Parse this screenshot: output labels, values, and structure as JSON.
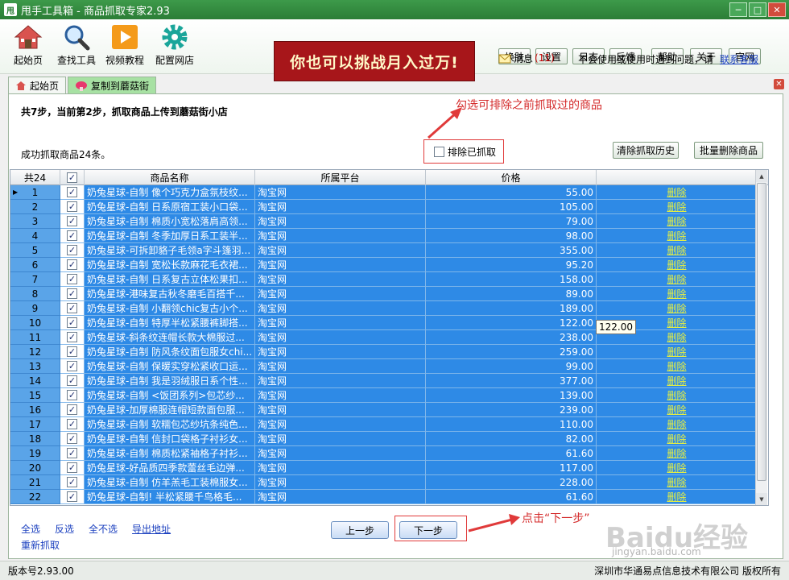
{
  "window": {
    "logo_text": "甩",
    "title": "甩手工具箱 - 商品抓取专家2.93",
    "buttons": [
      "─",
      "□",
      "✕"
    ]
  },
  "toolbar": {
    "tools": [
      {
        "label": "起始页",
        "icon": "home-icon"
      },
      {
        "label": "查找工具",
        "icon": "magnifier-icon"
      },
      {
        "label": "视频教程",
        "icon": "play-icon"
      },
      {
        "label": "配置网店",
        "icon": "gear-icon"
      }
    ],
    "banner": "你也可以挑战月入过万!",
    "top_buttons": [
      "换肤",
      "设置",
      "日志",
      "反馈",
      "帮助",
      "关于",
      "官网"
    ],
    "message_label": "消息",
    "message_count": "(11)",
    "help_text": "不会使用或使用时遇到问题，请",
    "help_link": "联系客服"
  },
  "tabs": [
    {
      "label": "起始页",
      "icon": "home-icon",
      "active": false
    },
    {
      "label": "复制到蘑菇街",
      "icon": "mushroom-icon",
      "active": true
    }
  ],
  "step": {
    "text": "共7步，当前第2步，抓取商品上传到蘑菇街小店",
    "success": "成功抓取商品24条。",
    "exclude_label": "排除已抓取",
    "clear_history": "清除抓取历史",
    "batch_delete": "批量删除商品",
    "annotation_top": "勾选可排除之前抓取过的商品",
    "annotation_next": "点击“下一步”"
  },
  "table": {
    "headers": [
      "共24",
      "",
      "商品名称",
      "所属平台",
      "价格",
      ""
    ],
    "rows": [
      {
        "n": "1",
        "name": "奶兔星球-自制 像个巧克力盒氛枝纹...",
        "platform": "淘宝网",
        "price": "55.00",
        "action": "删除"
      },
      {
        "n": "2",
        "name": "奶兔星球-自制 日系原宿工装小口袋...",
        "platform": "淘宝网",
        "price": "105.00",
        "action": "删除"
      },
      {
        "n": "3",
        "name": "奶兔星球-自制 棉质小宽松落肩高领...",
        "platform": "淘宝网",
        "price": "79.00",
        "action": "删除"
      },
      {
        "n": "4",
        "name": "奶兔星球-自制 冬季加厚日系工装半...",
        "platform": "淘宝网",
        "price": "98.00",
        "action": "删除"
      },
      {
        "n": "5",
        "name": "奶兔星球-可拆卸貉子毛领a字斗篷羽...",
        "platform": "淘宝网",
        "price": "355.00",
        "action": "删除"
      },
      {
        "n": "6",
        "name": "奶兔星球-自制 宽松长款麻花毛衣裙...",
        "platform": "淘宝网",
        "price": "95.20",
        "action": "删除"
      },
      {
        "n": "7",
        "name": "奶兔星球-自制 日系复古立体松果扣...",
        "platform": "淘宝网",
        "price": "158.00",
        "action": "删除"
      },
      {
        "n": "8",
        "name": "奶兔星球-港味复古秋冬磨毛百搭千...",
        "platform": "淘宝网",
        "price": "89.00",
        "action": "删除"
      },
      {
        "n": "9",
        "name": "奶兔星球-自制 小翻领chic复古小个...",
        "platform": "淘宝网",
        "price": "189.00",
        "action": "删除"
      },
      {
        "n": "10",
        "name": "奶兔星球-自制 特厚半松紧腰裤脚搭...",
        "platform": "淘宝网",
        "price": "122.00",
        "action": "删除"
      },
      {
        "n": "11",
        "name": "奶兔星球-斜条纹连帽长款大棉服过...",
        "platform": "淘宝网",
        "price": "238.00",
        "action": "删除"
      },
      {
        "n": "12",
        "name": "奶兔星球-自制 防风条纹面包服女chi...",
        "platform": "淘宝网",
        "price": "259.00",
        "action": "删除"
      },
      {
        "n": "13",
        "name": "奶兔星球-自制 保暖实穿松紧收口运...",
        "platform": "淘宝网",
        "price": "99.00",
        "action": "删除"
      },
      {
        "n": "14",
        "name": "奶兔星球-自制 我是羽绒服日系个性...",
        "platform": "淘宝网",
        "price": "377.00",
        "action": "删除"
      },
      {
        "n": "15",
        "name": "奶兔星球-自制 <饭团系列>包芯纱...",
        "platform": "淘宝网",
        "price": "139.00",
        "action": "删除"
      },
      {
        "n": "16",
        "name": "奶兔星球-加厚棉服连帽短款面包服...",
        "platform": "淘宝网",
        "price": "239.00",
        "action": "删除"
      },
      {
        "n": "17",
        "name": "奶兔星球-自制 软糯包芯纱坑条纯色...",
        "platform": "淘宝网",
        "price": "110.00",
        "action": "删除"
      },
      {
        "n": "18",
        "name": "奶兔星球-自制 信封口袋格子衬衫女...",
        "platform": "淘宝网",
        "price": "82.00",
        "action": "删除"
      },
      {
        "n": "19",
        "name": "奶兔星球-自制 棉质松紧袖格子衬衫...",
        "platform": "淘宝网",
        "price": "61.60",
        "action": "删除"
      },
      {
        "n": "20",
        "name": "奶兔星球-好品质四季款蕾丝毛边弹...",
        "platform": "淘宝网",
        "price": "117.00",
        "action": "删除"
      },
      {
        "n": "21",
        "name": "奶兔星球-自制 仿羊羔毛工装棉服女...",
        "platform": "淘宝网",
        "price": "228.00",
        "action": "删除"
      },
      {
        "n": "22",
        "name": "奶兔星球-自制! 半松紧腰千鸟格毛...",
        "platform": "淘宝网",
        "price": "61.60",
        "action": "删除"
      }
    ],
    "tooltip": "122.00"
  },
  "bottom": {
    "select_all": "全选",
    "invert": "反选",
    "select_none": "全不选",
    "export": "导出地址",
    "refetch": "重新抓取",
    "prev": "上一步",
    "next": "下一步"
  },
  "status": {
    "version": "版本号2.93.00",
    "copyright": "深圳市华通易点信息技术有限公司 版权所有"
  },
  "watermark": {
    "main": "Baidu经验",
    "sub": "jingyan.baidu.com"
  }
}
